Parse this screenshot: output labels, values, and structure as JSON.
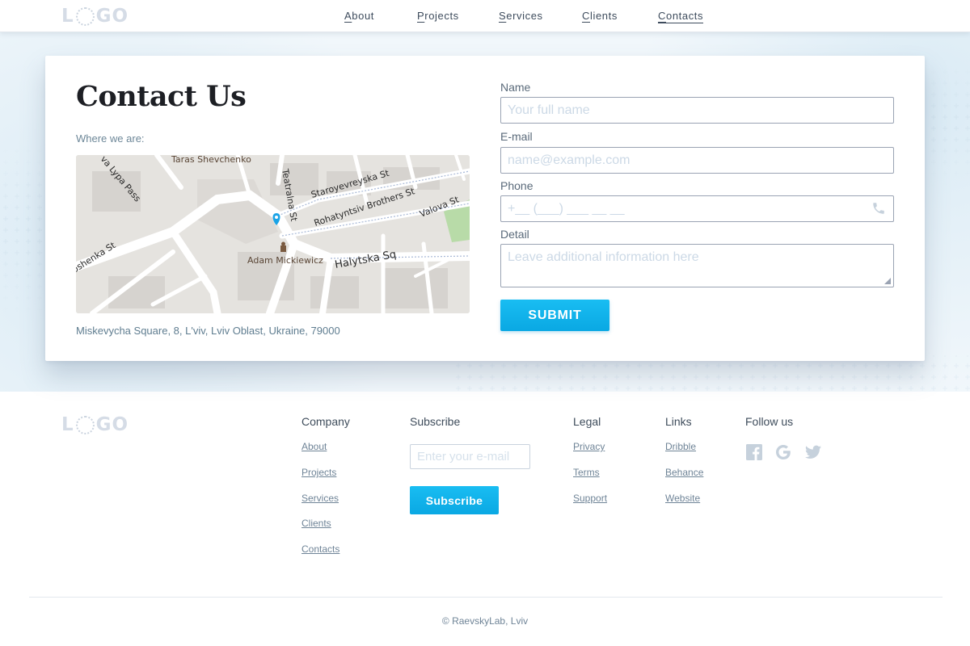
{
  "header": {
    "logo_text": "LOGO",
    "nav": [
      {
        "label": "About"
      },
      {
        "label": "Projects"
      },
      {
        "label": "Services"
      },
      {
        "label": "Clients"
      },
      {
        "label": "Contacts",
        "active": true
      }
    ]
  },
  "contact": {
    "title": "Contact Us",
    "where_label": "Where we are:",
    "address": "Miskevycha Square, 8, L'viv, Lviv Oblast, Ukraine, 79000",
    "map": {
      "labels": [
        "Taras Shevchenko",
        "va Lypa Pass",
        "Teatralna St",
        "Staroyevreyska St",
        "Rohatyntsiv Brothers St",
        "Valova St",
        "oshenka St",
        "Adam Mickiewicz",
        "Halytska Sq"
      ],
      "marker_color": "#1aa3e6",
      "park_color": "#b8dba8"
    }
  },
  "form": {
    "name_label": "Name",
    "name_placeholder": "Your full name",
    "email_label": "E-mail",
    "email_placeholder": "name@example.com",
    "phone_label": "Phone",
    "phone_placeholder": "+__ (___) ___ __ __",
    "detail_label": "Detail",
    "detail_placeholder": "Leave additional information here",
    "submit_label": "SUBMIT"
  },
  "footer": {
    "logo_text": "LOGO",
    "company": {
      "title": "Company",
      "links": [
        "About",
        "Projects",
        "Services",
        "Clients",
        "Contacts"
      ]
    },
    "subscribe": {
      "title": "Subscribe",
      "placeholder": "Enter your e-mail",
      "button_label": "Subscribe"
    },
    "legal": {
      "title": "Legal",
      "links": [
        "Privacy",
        "Terms",
        "Support"
      ]
    },
    "links": {
      "title": "Links",
      "links": [
        "Dribble",
        "Behance",
        "Website"
      ]
    },
    "follow": {
      "title": "Follow us",
      "icons": [
        "facebook-icon",
        "google-icon",
        "twitter-icon"
      ]
    },
    "copyright": "© RaevskyLab, Lviv"
  },
  "colors": {
    "accent": "#0ab0ea",
    "hero_bg": "#f1f7fb",
    "icon_muted": "#c6d1dc"
  }
}
